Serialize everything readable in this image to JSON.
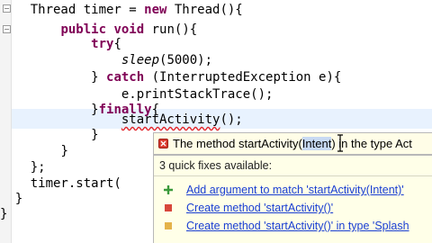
{
  "code": {
    "line1": {
      "indent": "    ",
      "t1": "Thread timer = ",
      "kw": "new",
      "t2": " Thread(){"
    },
    "line2": {
      "indent": "        ",
      "kw1": "public",
      "s1": " ",
      "kw2": "void",
      "t": " run(){"
    },
    "line3": {
      "indent": "            ",
      "kw": "try",
      "t": "{"
    },
    "line4": {
      "indent": "                ",
      "it": "sleep",
      "t": "(5000);"
    },
    "line5": {
      "indent": "            ",
      "t1": "} ",
      "kw": "catch",
      "t2": " (InterruptedException e){"
    },
    "line6": {
      "indent": "                ",
      "t": "e.printStackTrace();"
    },
    "line7": {
      "indent": "            ",
      "t1": "}",
      "kw": "finally",
      "t2": "{"
    },
    "line8": {
      "indent": "                ",
      "call": "startActivity",
      "t": "();"
    },
    "line9": {
      "indent": "            ",
      "t": "}"
    },
    "line10": {
      "indent": "        ",
      "t": "}"
    },
    "line11": {
      "indent": "    ",
      "t": "};"
    },
    "line12": {
      "indent": "    ",
      "t": "timer.start("
    },
    "line13": {
      "indent": "  ",
      "t": "}"
    },
    "line14": {
      "indent": "",
      "t": "}"
    }
  },
  "hover": {
    "pre": "The method startActivity(",
    "sel": "Intent",
    "post": ") in the type Act",
    "error_color": "#d83a2f"
  },
  "quickfix": {
    "header": "3 quick fixes available:",
    "items": [
      {
        "label": "Add argument to match 'startActivity(Intent)'",
        "icon": "add-argument-icon"
      },
      {
        "label": "Create method 'startActivity()'",
        "icon": "create-method-icon"
      },
      {
        "label": "Create method 'startActivity()' in type 'Splash",
        "icon": "create-method-in-type-icon"
      }
    ]
  },
  "colors": {
    "keyword": "#7f0055",
    "link": "#1b3fd2",
    "current_line": "#e8f2fe",
    "hover_bg": "#fffde7"
  }
}
